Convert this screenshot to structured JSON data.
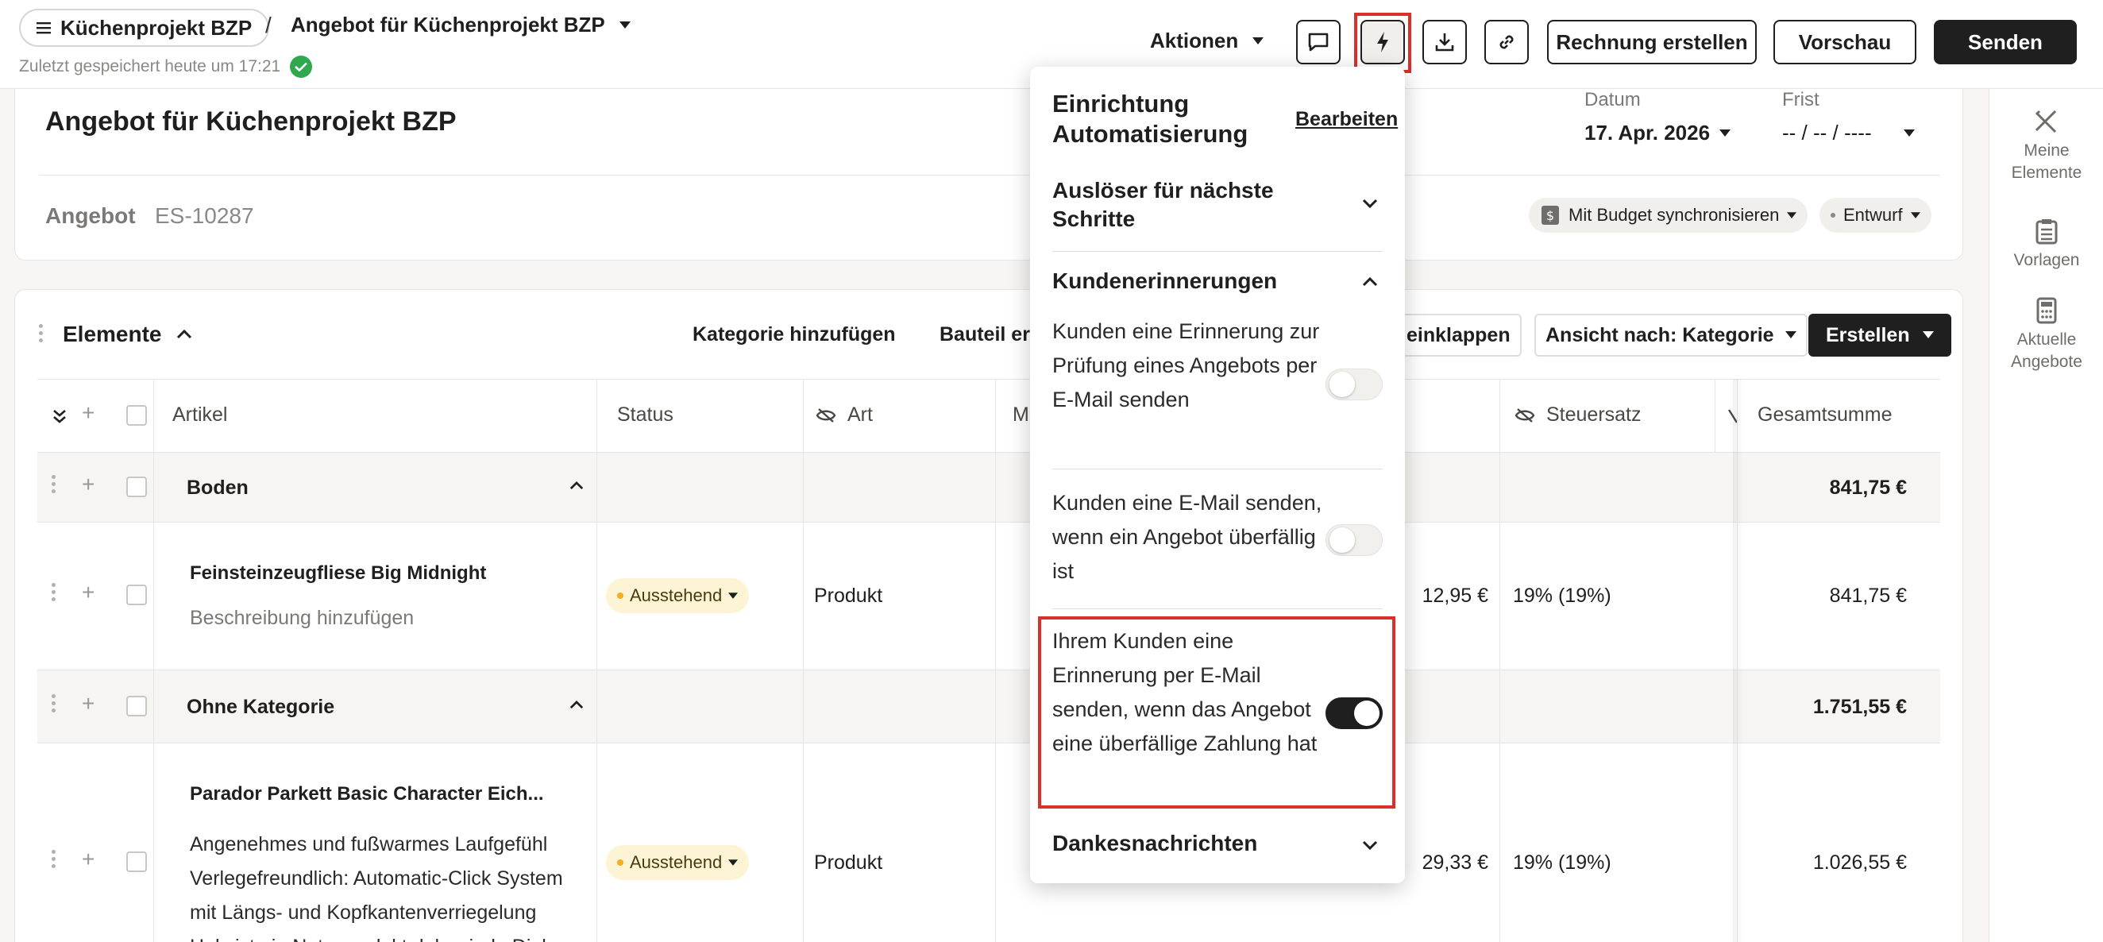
{
  "header": {
    "project_pill": "Küchenprojekt BZP",
    "separator": "/",
    "doc_title": "Angebot für Küchenprojekt BZP",
    "saved_status": "Zuletzt gespeichert heute um 17:21",
    "actions_label": "Aktionen",
    "invoice_button": "Rechnung erstellen",
    "preview_button": "Vorschau",
    "send_button": "Senden"
  },
  "document": {
    "title": "Angebot für Küchenprojekt BZP",
    "type": "Angebot",
    "number": "ES-10287",
    "date_label": "Datum",
    "date_value": "17. Apr. 2026",
    "due_label": "Frist",
    "due_value": "-- / -- / ----",
    "budget_sync": "Mit Budget synchronisieren",
    "status": "Entwurf"
  },
  "rail": {
    "items": [
      {
        "label": "Meine Elemente",
        "icon": "ruler-pencil-icon"
      },
      {
        "label": "Vorlagen",
        "icon": "clipboard-icon"
      },
      {
        "label": "Aktuelle Angebote",
        "icon": "calculator-icon"
      }
    ]
  },
  "elements": {
    "heading": "Elemente",
    "add_category": "Kategorie hinzufügen",
    "add_part": "Bauteil ers",
    "collapse": "einklappen",
    "view_by": "Ansicht nach: Kategorie",
    "create_button": "Erstellen",
    "columns": {
      "article": "Artikel",
      "status": "Status",
      "type": "Art",
      "qty": "Me",
      "tax": "Steuersatz",
      "total": "Gesamtsumme"
    },
    "rows": [
      {
        "kind": "category",
        "name": "Boden",
        "total": "841,75 €"
      },
      {
        "kind": "item",
        "name": "Feinsteinzeugfliese Big Midnight",
        "desc": "Beschreibung hinzufügen",
        "status": "Ausstehend",
        "type": "Produkt",
        "price": "12,95 €",
        "tax": "19% (19%)",
        "total": "841,75 €"
      },
      {
        "kind": "category",
        "name": "Ohne Kategorie",
        "total": "1.751,55 €"
      },
      {
        "kind": "item",
        "name": "Parador Parkett Basic Character Eich...",
        "desc_lines": [
          "Angenehmes und fußwarmes Laufgefühl",
          "Verlegefreundlich: Automatic-Click System",
          "mit Längs- und Kopfkantenverriegelung",
          "Holz ist ein Naturprodukt daher jede Diele ..."
        ],
        "status": "Ausstehend",
        "type": "Produkt",
        "price": "29,33 €",
        "tax": "19% (19%)",
        "total": "1.026,55 €"
      }
    ]
  },
  "automation": {
    "title": "Einrichtung Automatisierung",
    "edit": "Bearbeiten",
    "section_triggers": "Auslöser für nächste Schritte",
    "section_reminders": "Kundenerinnerungen",
    "options": [
      {
        "label": "Kunden eine Erinnerung zur Prüfung eines Angebots per E-Mail senden",
        "enabled": false
      },
      {
        "label": "Kunden eine E-Mail senden, wenn ein Angebot überfällig ist",
        "enabled": false
      },
      {
        "label": "Ihrem Kunden eine Erinnerung per E-Mail senden, wenn das Angebot eine überfällige Zahlung hat",
        "enabled": true
      }
    ],
    "section_thanks": "Dankesnachrichten"
  },
  "colors": {
    "highlight": "#d9302a",
    "success": "#2fa84f",
    "pending": "#f2b01e",
    "dark": "#1f1f1f"
  }
}
